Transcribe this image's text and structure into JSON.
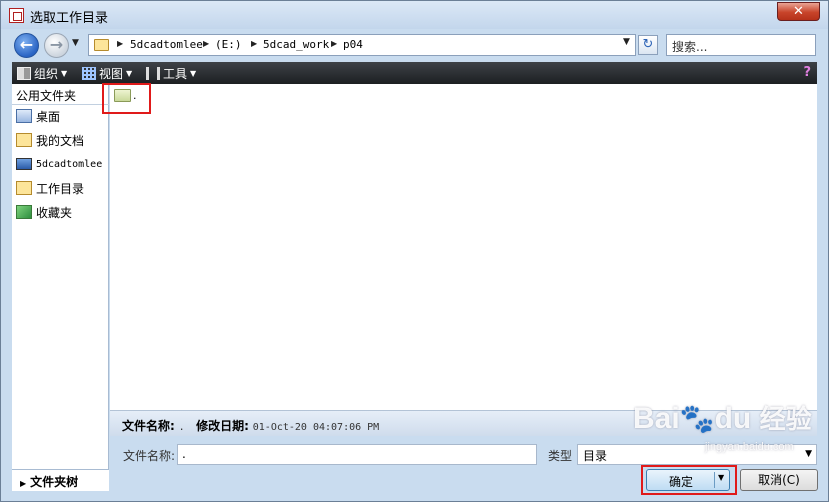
{
  "window": {
    "title": "选取工作目录",
    "close_label": "✕"
  },
  "address": {
    "crumbs": [
      "5dcadtomlee",
      "(E:)",
      "5dcad_work",
      "p04"
    ],
    "search_placeholder": "搜索..."
  },
  "toolbar": {
    "organize": "组织",
    "view": "视图",
    "tools": "工具"
  },
  "sidebar": {
    "header": "公用文件夹",
    "items": [
      {
        "label": "桌面",
        "icon": "desktop-icon"
      },
      {
        "label": "我的文档",
        "icon": "documents-icon"
      },
      {
        "label": "5dcadtomlee",
        "icon": "computer-icon"
      },
      {
        "label": "工作目录",
        "icon": "working-folder-icon"
      },
      {
        "label": "收藏夹",
        "icon": "favorites-icon"
      }
    ],
    "tree_toggle": "文件夹树"
  },
  "files": [
    {
      "name": ".",
      "icon": "folder-icon"
    }
  ],
  "details": {
    "name_label": "文件名称:",
    "name_value": ".",
    "date_label": "修改日期:",
    "date_value": "01-Oct-20 04:07:06 PM"
  },
  "form": {
    "name_label": "文件名称:",
    "name_value": ".",
    "type_label": "类型",
    "type_value": "目录"
  },
  "buttons": {
    "ok": "确定",
    "cancel": "取消(C)"
  },
  "watermark": {
    "brand": "Bai",
    "brand2": "du",
    "zh": "经验",
    "sub": "jingyan.baidu.com"
  }
}
